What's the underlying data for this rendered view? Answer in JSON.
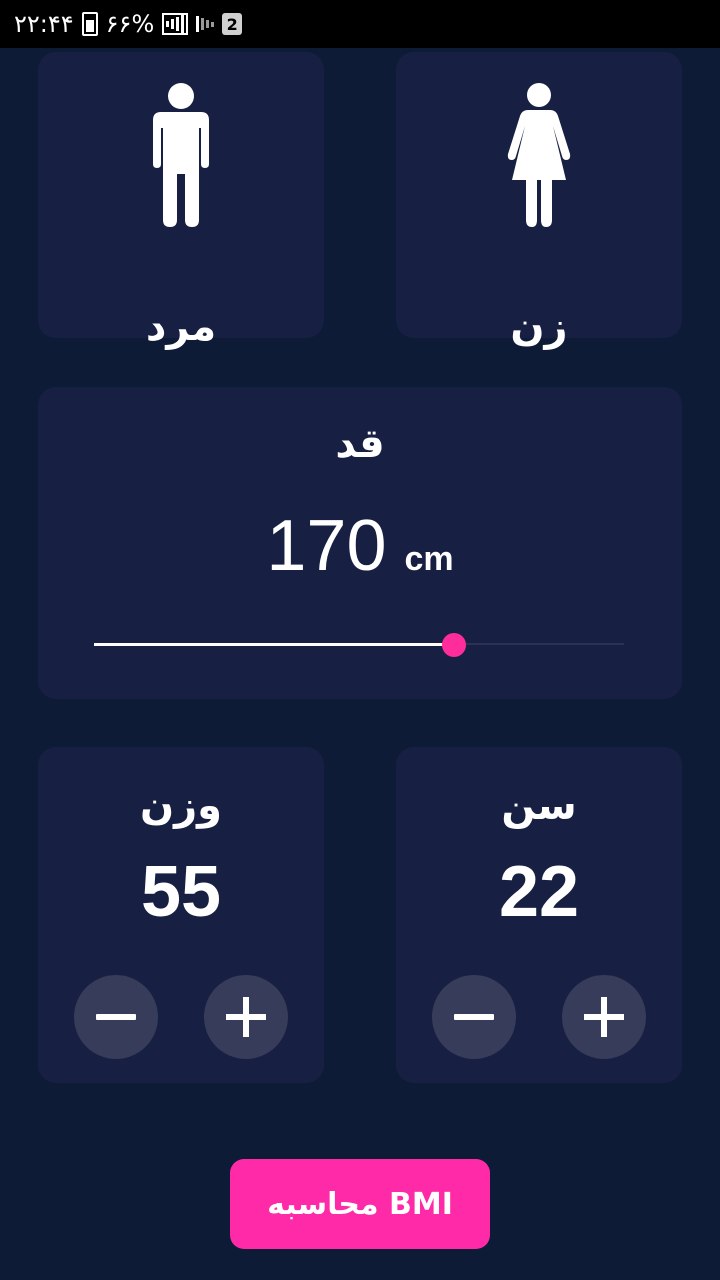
{
  "status_bar": {
    "time": "۲۲:۴۴",
    "battery": "۶۶%",
    "sim_badge": "2",
    "icons": [
      "battery-icon",
      "signal-icon",
      "signal-weak-icon",
      "sim-icon"
    ]
  },
  "gender": {
    "male_label": "مرد",
    "female_label": "زن",
    "male_icon": "male-figure-icon",
    "female_icon": "female-figure-icon"
  },
  "height": {
    "label": "قد",
    "value": "170",
    "unit": "cm",
    "slider_fraction": 0.68
  },
  "weight": {
    "label": "وزن",
    "value": "55"
  },
  "age": {
    "label": "سن",
    "value": "22"
  },
  "calculate_button": "محاسبه BMI",
  "colors": {
    "background": "#0d1b36",
    "card": "#172042",
    "accent": "#ff2aa8",
    "button_circle": "#363c5a"
  }
}
